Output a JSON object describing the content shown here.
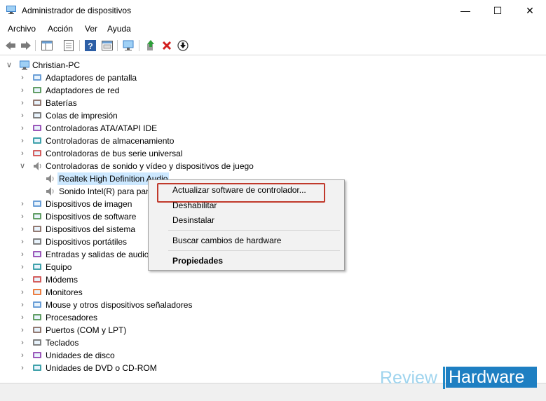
{
  "window": {
    "title": "Administrador de dispositivos"
  },
  "menu": [
    "Archivo",
    "Acción",
    "Ver",
    "Ayuda"
  ],
  "tree": {
    "root": "Christian-PC",
    "categories": [
      "Adaptadores de pantalla",
      "Adaptadores de red",
      "Baterías",
      "Colas de impresión",
      "Controladoras ATA/ATAPI IDE",
      "Controladoras de almacenamiento",
      "Controladoras de bus serie universal",
      "Controladoras de sonido y vídeo y dispositivos de juego",
      "Dispositivos de imagen",
      "Dispositivos de software",
      "Dispositivos del sistema",
      "Dispositivos portátiles",
      "Entradas y salidas de audio",
      "Equipo",
      "Módems",
      "Monitores",
      "Mouse y otros dispositivos señaladores",
      "Procesadores",
      "Puertos (COM y LPT)",
      "Teclados",
      "Unidades de disco",
      "Unidades de DVD o CD-ROM"
    ],
    "sound_children": [
      "Realtek High Definition Audio",
      "Sonido Intel(R) para pan"
    ]
  },
  "context_menu": {
    "update": "Actualizar software de controlador...",
    "disable": "Deshabilitar",
    "uninstall": "Desinstalar",
    "scan": "Buscar cambios de hardware",
    "properties": "Propiedades"
  },
  "watermark": {
    "review": "Review",
    "hardware": "Hardware"
  },
  "colors": {
    "selection": "#cce8ff",
    "highlight_box": "#c0392b",
    "brand_blue": "#1e7fc2"
  }
}
